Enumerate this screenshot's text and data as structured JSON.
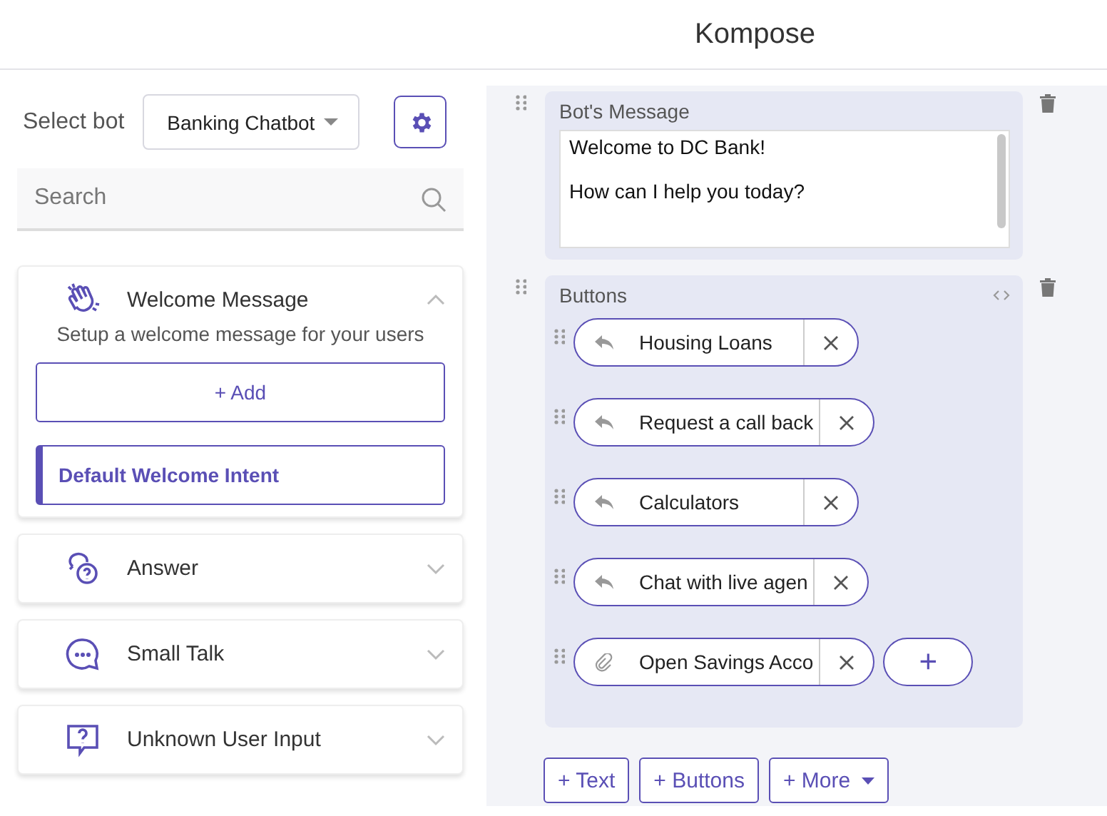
{
  "header": {
    "title": "Kompose"
  },
  "sidebar": {
    "select_label": "Select bot",
    "bot_dropdown": "Banking Chatbot",
    "search": {
      "placeholder": "Search"
    },
    "sections": [
      {
        "kind": "wave",
        "title": "Welcome Message",
        "expanded": true,
        "description": "Setup a welcome message for your users",
        "add_label": "+ Add",
        "intents": [
          {
            "label": "Default Welcome Intent",
            "selected": true
          }
        ]
      },
      {
        "kind": "answer",
        "title": "Answer",
        "expanded": false
      },
      {
        "kind": "chat",
        "title": "Small Talk",
        "expanded": false
      },
      {
        "kind": "question",
        "title": "Unknown User Input",
        "expanded": false
      }
    ]
  },
  "editor": {
    "message_card": {
      "title": "Bot's Message",
      "lines": [
        "Welcome to DC Bank!",
        "How can I help you today?"
      ]
    },
    "buttons_card": {
      "title": "Buttons",
      "buttons": [
        {
          "kind": "reply",
          "label": "Housing Loans"
        },
        {
          "kind": "reply",
          "label": "Request a call back"
        },
        {
          "kind": "reply",
          "label": "Calculators"
        },
        {
          "kind": "reply",
          "label": "Chat with live agen"
        },
        {
          "kind": "link",
          "label": "Open Savings Acco"
        }
      ],
      "add_label": "+"
    },
    "actions": [
      {
        "label": "+ Text",
        "dropdown": false
      },
      {
        "label": "+ Buttons",
        "dropdown": false
      },
      {
        "label": "+ More",
        "dropdown": true
      }
    ]
  }
}
